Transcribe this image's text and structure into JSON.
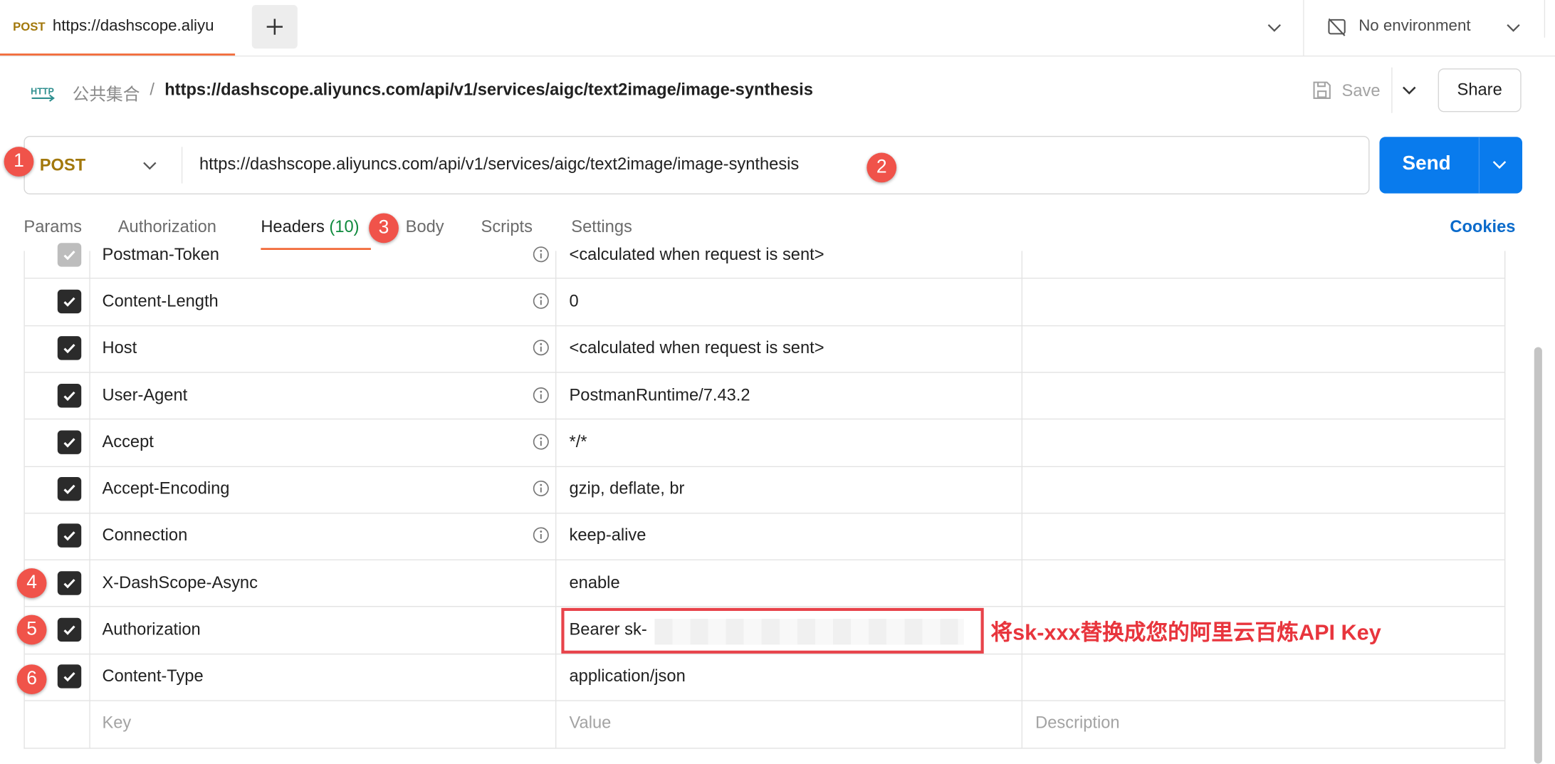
{
  "tab": {
    "method": "POST",
    "url": "https://dashscope.aliyu"
  },
  "environment": {
    "label": "No environment"
  },
  "breadcrumb": {
    "collection": "公共集合",
    "separator": "/",
    "request_url": "https://dashscope.aliyuncs.com/api/v1/services/aigc/text2image/image-synthesis"
  },
  "toolbar": {
    "save_label": "Save",
    "share_label": "Share"
  },
  "request": {
    "method": "POST",
    "url": "https://dashscope.aliyuncs.com/api/v1/services/aigc/text2image/image-synthesis",
    "send_label": "Send"
  },
  "request_tabs": {
    "params": "Params",
    "authorization": "Authorization",
    "headers": "Headers",
    "headers_count": "(10)",
    "body": "Body",
    "scripts": "Scripts",
    "settings": "Settings",
    "cookies": "Cookies"
  },
  "headers": [
    {
      "key": "Postman-Token",
      "value": "<calculated when request is sent>",
      "checked": true,
      "info": true
    },
    {
      "key": "Content-Length",
      "value": "0",
      "checked": true,
      "info": true
    },
    {
      "key": "Host",
      "value": "<calculated when request is sent>",
      "checked": true,
      "info": true
    },
    {
      "key": "User-Agent",
      "value": "PostmanRuntime/7.43.2",
      "checked": true,
      "info": true
    },
    {
      "key": "Accept",
      "value": "*/*",
      "checked": true,
      "info": true
    },
    {
      "key": "Accept-Encoding",
      "value": "gzip, deflate, br",
      "checked": true,
      "info": true
    },
    {
      "key": "Connection",
      "value": "keep-alive",
      "checked": true,
      "info": true
    },
    {
      "key": "X-DashScope-Async",
      "value": "enable",
      "checked": true,
      "info": false
    },
    {
      "key": "Authorization",
      "value": "Bearer sk-",
      "checked": true,
      "info": false
    },
    {
      "key": "Content-Type",
      "value": "application/json",
      "checked": true,
      "info": false
    }
  ],
  "placeholders": {
    "key": "Key",
    "value": "Value",
    "description": "Description"
  },
  "annotations": {
    "step_1": "1",
    "step_2": "2",
    "step_3": "3",
    "step_4": "4",
    "step_5": "5",
    "step_6": "6",
    "api_key_note": "将sk-xxx替换成您的阿里云百炼API Key"
  },
  "colors": {
    "accent": "#f26b3a",
    "send": "#097bed",
    "method": "#a2780c",
    "annotation": "#e8353d"
  }
}
